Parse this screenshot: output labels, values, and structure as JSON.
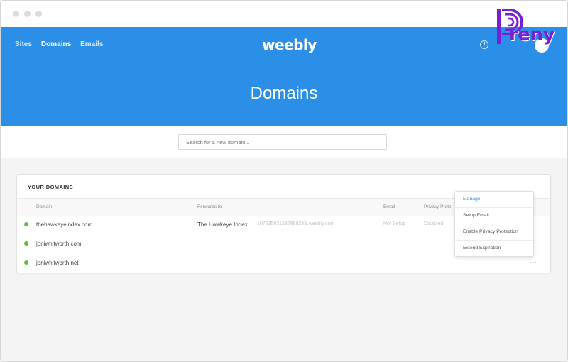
{
  "nav": {
    "items": [
      {
        "label": "Sites",
        "active": false
      },
      {
        "label": "Domains",
        "active": true
      },
      {
        "label": "Emails",
        "active": false
      }
    ]
  },
  "header": {
    "logo": "weebly",
    "title": "Domains",
    "icons": [
      "clock-icon",
      "avatar"
    ]
  },
  "search": {
    "placeholder": "Search for a new domain..."
  },
  "domains": {
    "section_title": "YOUR DOMAINS",
    "columns": [
      "Domain",
      "Forwards to",
      "Email",
      "Privacy Prote"
    ],
    "rows": [
      {
        "status": "active",
        "domain": "thehawkeyeindex.com",
        "forwards_to": "The Hawkeye Index",
        "forwards_url": "10753593128786825S.weebly.com",
        "email": "Not Setup",
        "privacy": "Disabled"
      },
      {
        "status": "active",
        "domain": "joniwhitworth.com",
        "forwards_to": "",
        "forwards_url": "",
        "email": "",
        "privacy": ""
      },
      {
        "status": "active",
        "domain": "joniwhitworth.net",
        "forwards_to": "",
        "forwards_url": "",
        "email": "",
        "privacy": ""
      }
    ],
    "more_label": "…"
  },
  "context_menu": {
    "items": [
      {
        "label": "Manage",
        "active": true
      },
      {
        "label": "Setup Email",
        "active": false
      },
      {
        "label": "Enable Privacy Protection",
        "active": false
      },
      {
        "label": "Extend Expiration",
        "active": false
      }
    ]
  },
  "watermark": {
    "text": "reny"
  },
  "colors": {
    "brand_blue": "#2b8fe8",
    "status_green": "#5fbe3e",
    "watermark_purple": "#7a1fd6"
  }
}
